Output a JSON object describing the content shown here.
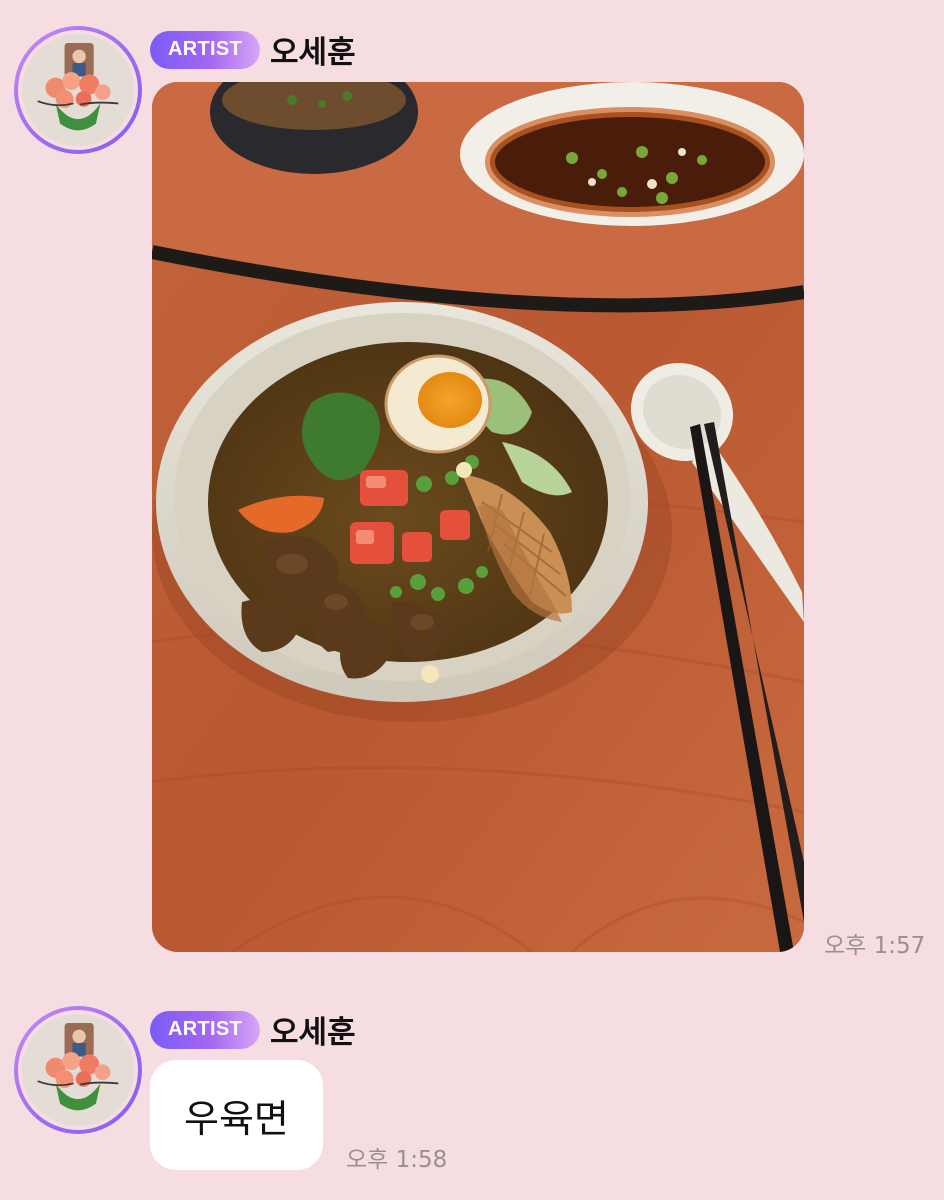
{
  "messages": [
    {
      "badge": "ARTIST",
      "sender": "오세훈",
      "type": "image",
      "time": "오후 1:57"
    },
    {
      "badge": "ARTIST",
      "sender": "오세훈",
      "type": "text",
      "text": "우육면",
      "time": "오후 1:58"
    }
  ],
  "colors": {
    "background": "#f5dde2",
    "badge_start": "#7b5cf5",
    "badge_end": "#d7a6f6",
    "bubble": "#ffffff",
    "timestamp": "#9a9093"
  },
  "icons": {
    "avatar": "profile-photo-bouquet"
  }
}
